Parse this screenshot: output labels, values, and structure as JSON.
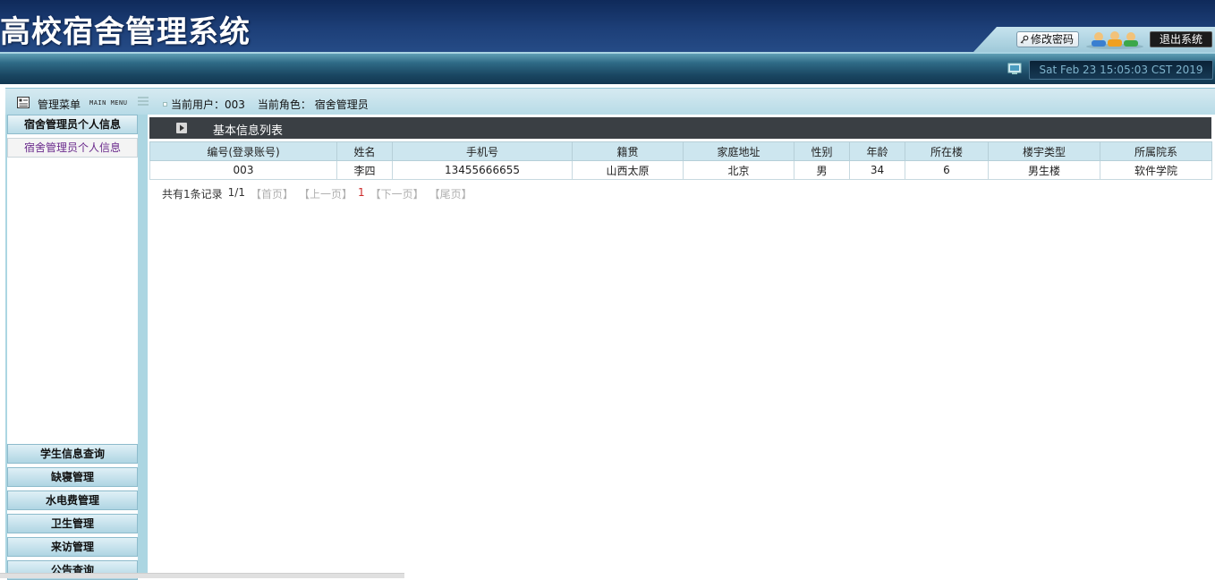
{
  "header": {
    "title": "高校宿舍管理系统",
    "change_password_label": "修改密码",
    "logout_label": "退出系统"
  },
  "topbar": {
    "datetime": "Sat Feb 23 15:05:03 CST 2019"
  },
  "menu": {
    "title": "管理菜单",
    "subtitle": "MAIN MENU",
    "current_user_text": "当前用户：003",
    "current_role_text": "当前角色：  宿舍管理员"
  },
  "sidebar": {
    "section_title": "宿舍管理员个人信息",
    "active_item": "宿舍管理员个人信息",
    "items": [
      {
        "label": "学生信息查询"
      },
      {
        "label": "缺寝管理"
      },
      {
        "label": "水电费管理"
      },
      {
        "label": "卫生管理"
      },
      {
        "label": "来访管理"
      },
      {
        "label": "公告查询"
      }
    ]
  },
  "main": {
    "list_title": "基本信息列表",
    "columns": [
      "编号(登录账号)",
      "姓名",
      "手机号",
      "籍贯",
      "家庭地址",
      "性别",
      "年龄",
      "所在楼",
      "楼宇类型",
      "所属院系"
    ],
    "rows": [
      [
        "003",
        "李四",
        "13455666655",
        "山西太原",
        "北京",
        "男",
        "34",
        "6",
        "男生楼",
        "软件学院"
      ]
    ],
    "pager": {
      "summary": "共有1条记录",
      "page_info": "1/1",
      "first": "【首页】",
      "prev": "【上一页】",
      "current": "1",
      "next": "【下一页】",
      "last": "【尾页】"
    }
  },
  "icons": {
    "key": "key-icon",
    "users": "users-icon",
    "monitor": "monitor-icon",
    "menu": "menu-icon",
    "play": "play-icon"
  },
  "colors": {
    "header_bg": "#1d3f78",
    "topbar_bg": "#1a4762",
    "accent_light": "#acd6e2",
    "list_title_bg": "#3a3f44",
    "table_header_bg": "#cde6ef",
    "pager_current": "#cc2a2a"
  }
}
